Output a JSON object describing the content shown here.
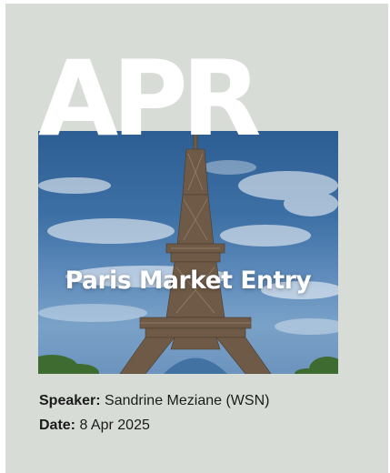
{
  "card": {
    "month": "APR",
    "title": "Paris Market Entry",
    "speaker_label": "Speaker:",
    "speaker_value": "Sandrine Meziane (WSN)",
    "date_label": "Date:",
    "date_value": "8 Apr 2025"
  },
  "image": {
    "subject": "eiffel-tower-photo"
  },
  "colors": {
    "card_background": "#d7ddd6",
    "text_white": "#ffffff",
    "text_dark": "#1b1b1b",
    "sky": "#3d70a5",
    "tower": "#6e5a46"
  }
}
